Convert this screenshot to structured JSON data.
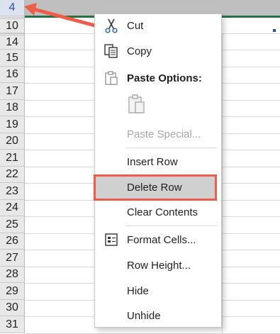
{
  "row_headers": [
    {
      "label": "4",
      "selected": true
    },
    {
      "label": "10",
      "selected": false,
      "after_hidden": true
    },
    {
      "label": "14",
      "selected": false,
      "after_hidden": true
    },
    {
      "label": "15",
      "selected": false
    },
    {
      "label": "16",
      "selected": false
    },
    {
      "label": "17",
      "selected": false
    },
    {
      "label": "18",
      "selected": false
    },
    {
      "label": "19",
      "selected": false
    },
    {
      "label": "20",
      "selected": false
    },
    {
      "label": "21",
      "selected": false
    },
    {
      "label": "22",
      "selected": false
    },
    {
      "label": "23",
      "selected": false
    },
    {
      "label": "24",
      "selected": false
    },
    {
      "label": "25",
      "selected": false
    },
    {
      "label": "26",
      "selected": false
    },
    {
      "label": "27",
      "selected": false
    },
    {
      "label": "28",
      "selected": false
    },
    {
      "label": "29",
      "selected": false
    },
    {
      "label": "30",
      "selected": false
    },
    {
      "label": "31",
      "selected": false
    }
  ],
  "context_menu": {
    "cut": "Cut",
    "copy": "Copy",
    "paste_options": "Paste Options:",
    "paste_special": "Paste Special...",
    "insert_row": "Insert Row",
    "delete_row": "Delete Row",
    "clear_contents": "Clear Contents",
    "format_cells": "Format Cells...",
    "row_height": "Row Height...",
    "hide": "Hide",
    "unhide": "Unhide"
  },
  "colors": {
    "annotation": "#ee5c4a",
    "selected_row_text": "#2b4cc4",
    "selection_edge": "#217346"
  },
  "icons": {
    "cut": "scissors-icon",
    "copy": "copy-icon",
    "paste": "clipboard-icon",
    "format_cells": "format-cells-icon",
    "annotation": "arrow-icon"
  }
}
